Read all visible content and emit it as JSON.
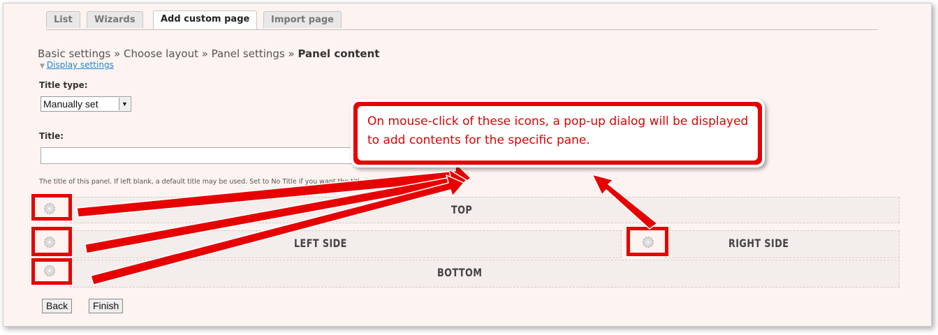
{
  "tabs": [
    {
      "label": "List",
      "active": false
    },
    {
      "label": "Wizards",
      "active": false
    },
    {
      "label": "Add custom page",
      "active": true
    },
    {
      "label": "Import page",
      "active": false
    }
  ],
  "breadcrumb": {
    "prefix": "Basic settings » Choose layout » Panel settings » ",
    "current": "Panel content"
  },
  "display_settings_link": "Display settings",
  "form": {
    "title_type_label": "Title type:",
    "title_type_value": "Manually set",
    "title_label": "Title:",
    "title_value": "",
    "description": "The title of this panel. If left blank, a default title may be used. Set to No Title if you want the title to actually be blank."
  },
  "panes": {
    "top": "TOP",
    "left": "LEFT SIDE",
    "right": "RIGHT SIDE",
    "bottom": "BOTTOM"
  },
  "buttons": {
    "back": "Back",
    "finish": "Finish"
  },
  "callout": "On mouse-click of these icons, a pop-up dialog will be displayed to add contents for the specific pane.",
  "colors": {
    "annotation": "#e60000",
    "background": "#fdf3f0"
  }
}
